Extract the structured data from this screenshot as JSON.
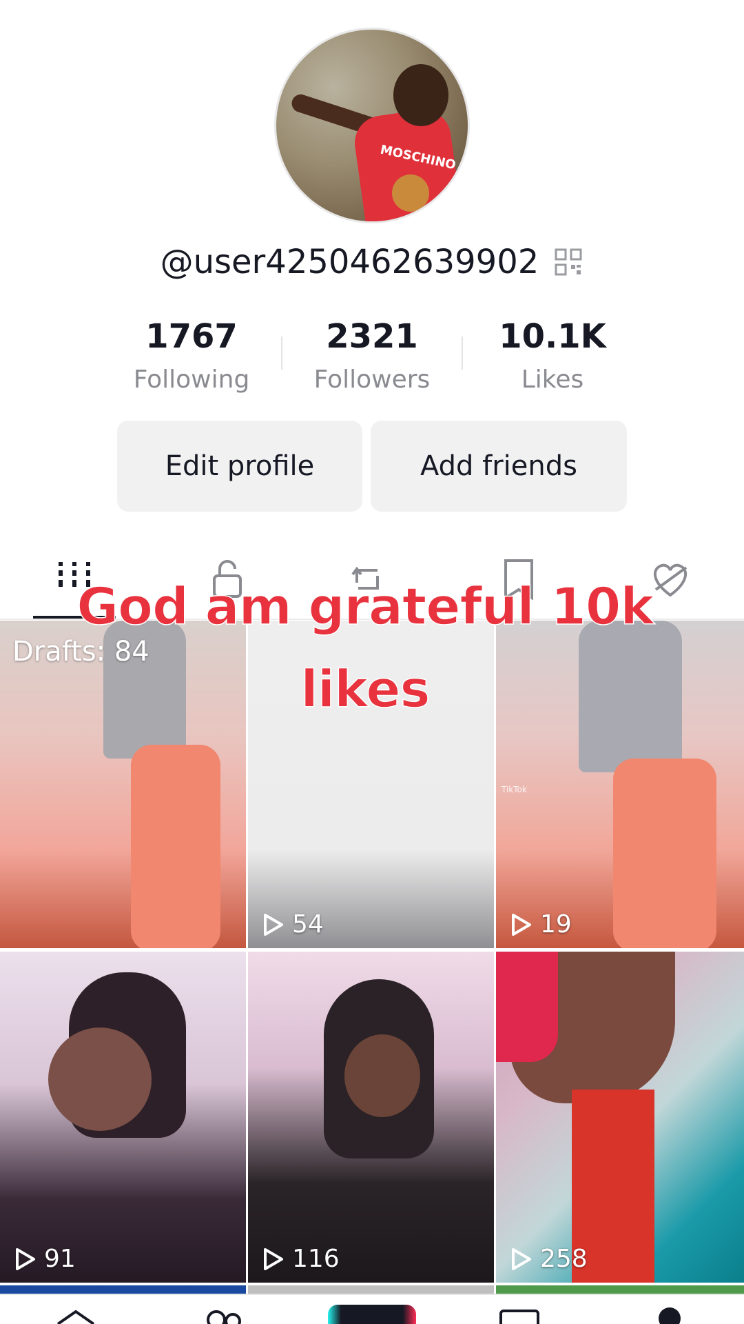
{
  "profile": {
    "username": "@user4250462639902",
    "stats": [
      {
        "value": "1767",
        "label": "Following"
      },
      {
        "value": "2321",
        "label": "Followers"
      },
      {
        "value": "10.1K",
        "label": "Likes"
      }
    ],
    "avatar_shirt_text": "MOSCHINO"
  },
  "buttons": {
    "edit_profile": "Edit profile",
    "add_friends": "Add friends"
  },
  "tabs": [
    {
      "icon": "grid-icon",
      "active": true
    },
    {
      "icon": "lock-icon",
      "active": false
    },
    {
      "icon": "repost-icon",
      "active": false
    },
    {
      "icon": "bookmark-icon",
      "active": false
    },
    {
      "icon": "heart-hidden-icon",
      "active": false
    }
  ],
  "caption": {
    "line1": "God am grateful 10k",
    "line2": "likes"
  },
  "videos": [
    {
      "drafts_label": "Drafts: 84"
    },
    {
      "views": "54"
    },
    {
      "views": "19",
      "watermark": "TikTok"
    },
    {
      "views": "91"
    },
    {
      "views": "116"
    },
    {
      "views": "258"
    }
  ],
  "colors": {
    "caption": "#e8333f",
    "text_primary": "#161823",
    "text_secondary": "#8a8b91",
    "button_bg": "#f1f1f2"
  }
}
